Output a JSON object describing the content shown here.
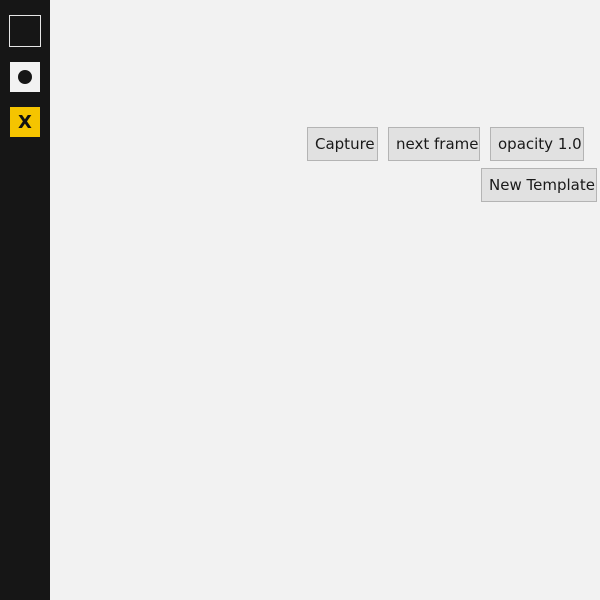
{
  "sidebar": {
    "tools": [
      {
        "icon": "rectangle-tool-icon"
      },
      {
        "icon": "circle-tool-icon"
      },
      {
        "icon": "close-icon",
        "label": "X",
        "color": "#f5c400"
      }
    ],
    "background": "#161616"
  },
  "toolbar": {
    "capture_label": "Capture",
    "next_frame_label": "next frame",
    "opacity_label": "opacity 1.0",
    "new_template_label": "New Template"
  },
  "colors": {
    "canvas": "#f2f2f2",
    "sidebar": "#161616",
    "accent": "#f5c400",
    "button_bg": "#e1e1e1",
    "button_border": "#b4b4b4"
  }
}
